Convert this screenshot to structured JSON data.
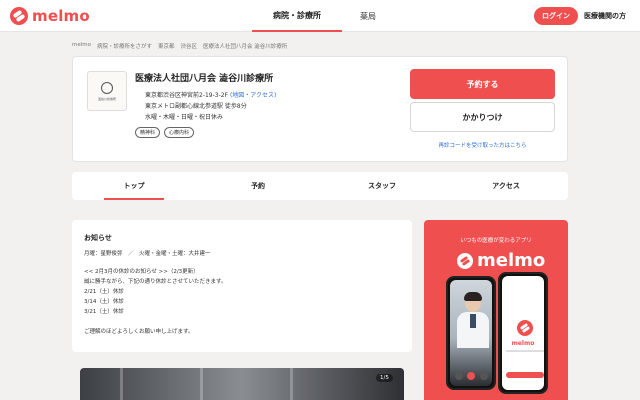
{
  "header": {
    "logo_text": "melmo",
    "nav": [
      {
        "label": "病院・診療所",
        "active": true
      },
      {
        "label": "薬局",
        "active": false
      }
    ],
    "login_label": "ログイン",
    "clinic_link": "医療機関の方"
  },
  "breadcrumb": [
    "melmo",
    "病院・診療所をさがす",
    "東京都",
    "渋谷区",
    "医療法人社団八月会 澁谷川診療所"
  ],
  "clinic": {
    "logo_text": "澁谷川診療所",
    "name": "医療法人社団八月会 澁谷川診療所",
    "address": "東京都渋谷区神宮前2-19-3-2F",
    "map_link": "(地図・アクセス)",
    "access": "東京メトロ副都心線北参道駅 徒歩8分",
    "closed_days": "水曜・木曜・日曜・祝日休み",
    "tags": [
      "精神科",
      "心療内科"
    ],
    "reserve_label": "予約する",
    "kakaritsuke_label": "かかりつけ",
    "code_link": "再診コードを受け取った方はこちら"
  },
  "tabs": [
    {
      "label": "トップ",
      "active": true
    },
    {
      "label": "予約",
      "active": false
    },
    {
      "label": "スタッフ",
      "active": false
    },
    {
      "label": "アクセス",
      "active": false
    }
  ],
  "notice": {
    "title": "お知らせ",
    "lines": [
      "月曜：星野俊弥　／　火曜・金曜・土曜：大井建一",
      "",
      "<< 2月3月の休診のお知らせ >>（2/3更新）",
      "誠に勝手ながら、下記の通り休診とさせていただきます。",
      "2/21（土）休診",
      "3/14（土）休診",
      "3/21（土）休診",
      "",
      "ご理解のほどよろしくお願い申し上げます。"
    ]
  },
  "photo": {
    "counter": "1/5"
  },
  "promo": {
    "tagline": "いつもの医療が変わるアプリ",
    "brand": "melmo",
    "app_name": "melmo"
  },
  "colors": {
    "accent": "#ef4f4f",
    "link": "#2f6fd6",
    "background": "#f2f1ef"
  }
}
